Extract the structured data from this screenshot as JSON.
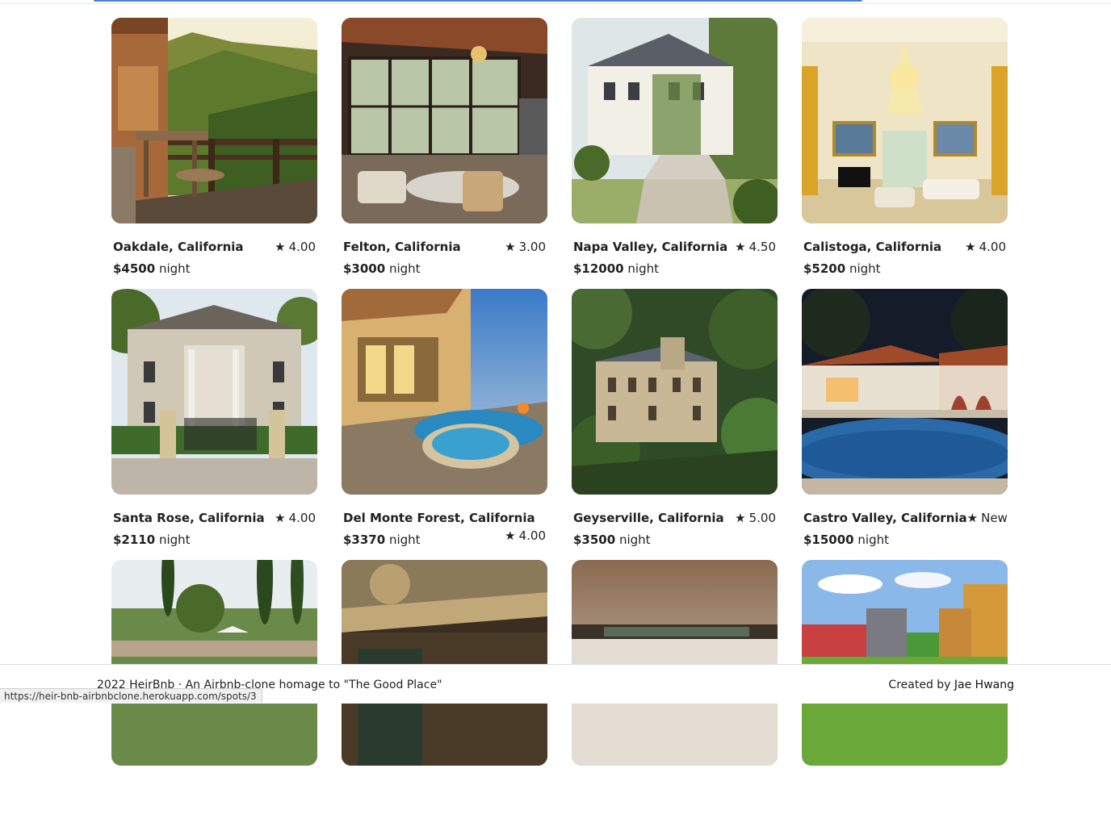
{
  "listings": [
    {
      "location": "Oakdale, California",
      "rating": "4.00",
      "price": "$4500",
      "unit": "night"
    },
    {
      "location": "Felton, California",
      "rating": "3.00",
      "price": "$3000",
      "unit": "night"
    },
    {
      "location": "Napa Valley, California",
      "rating": "4.50",
      "price": "$12000",
      "unit": "night"
    },
    {
      "location": "Calistoga, California",
      "rating": "4.00",
      "price": "$5200",
      "unit": "night"
    },
    {
      "location": "Santa Rose, California",
      "rating": "4.00",
      "price": "$2110",
      "unit": "night"
    },
    {
      "location": "Del Monte Forest, California",
      "rating": "4.00",
      "price": "$3370",
      "unit": "night"
    },
    {
      "location": "Geyserville, California",
      "rating": "5.00",
      "price": "$3500",
      "unit": "night"
    },
    {
      "location": "Castro Valley, California",
      "rating": "New",
      "price": "$15000",
      "unit": "night"
    }
  ],
  "star_glyph": "★",
  "footer": {
    "left": "2022 HeirBnb · An Airbnb-clone homage to \"The Good Place\"",
    "right_prefix": "Created by ",
    "right_name": "Jae Hwang"
  },
  "status_url": "https://heir-bnb-airbnbclone.herokuapp.com/spots/3",
  "colors": {
    "accent": "#4f7fd6",
    "text": "#222222"
  }
}
